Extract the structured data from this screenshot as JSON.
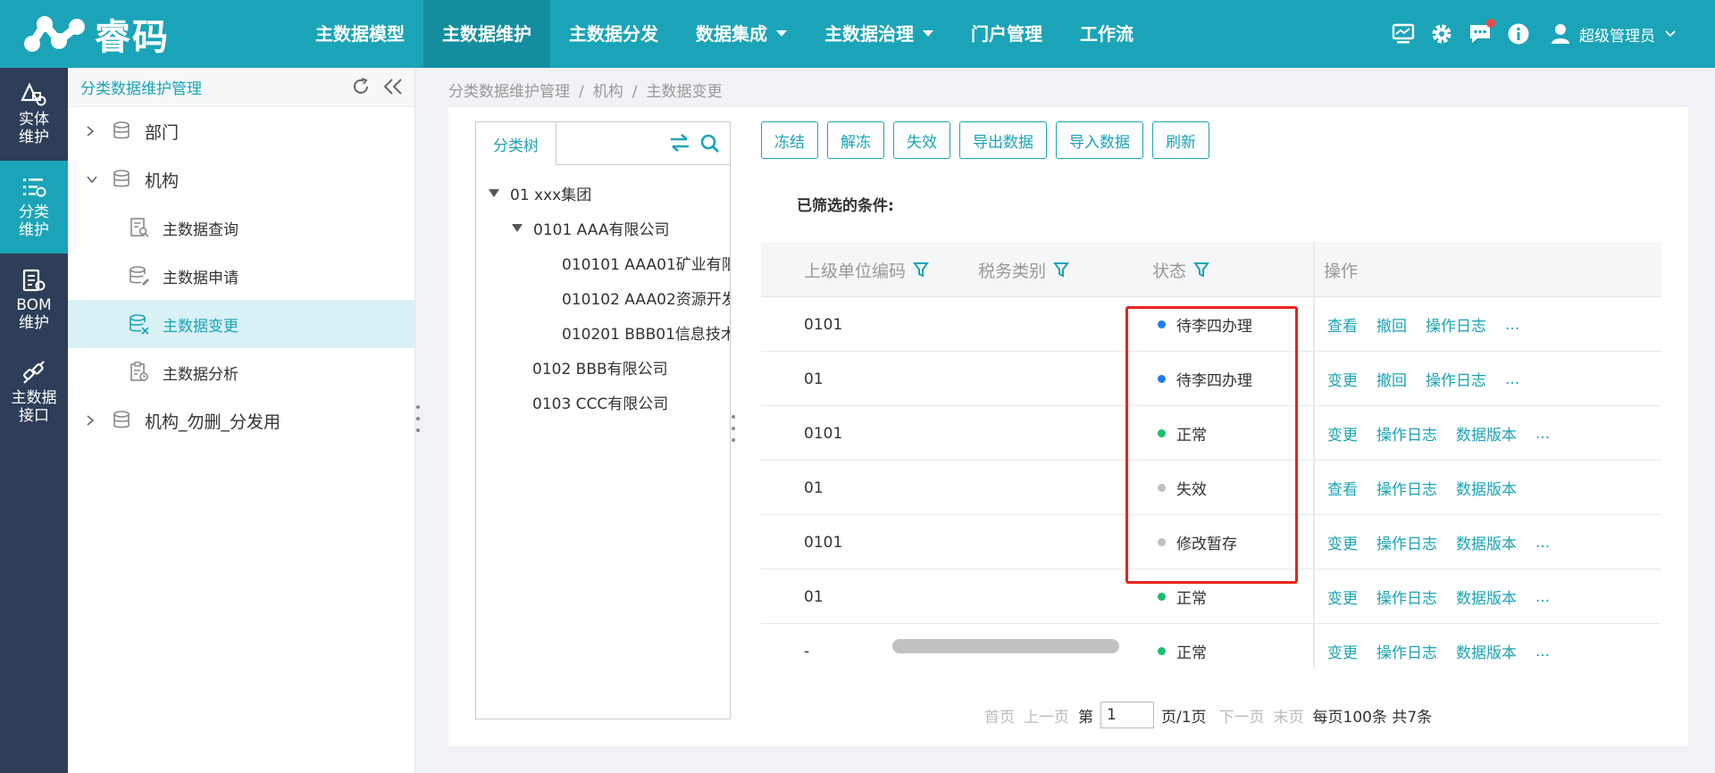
{
  "brand": {
    "name": "睿码"
  },
  "nav": {
    "items": [
      {
        "label": "主数据模型"
      },
      {
        "label": "主数据维护",
        "active": true
      },
      {
        "label": "主数据分发"
      },
      {
        "label": "数据集成",
        "dropdown": true
      },
      {
        "label": "主数据治理",
        "dropdown": true
      },
      {
        "label": "门户管理"
      },
      {
        "label": "工作流"
      }
    ]
  },
  "topbar": {
    "icons": [
      "monitor-icon",
      "gear-icon",
      "message-icon",
      "info-icon"
    ],
    "user": {
      "name": "超级管理员"
    }
  },
  "left_nav": {
    "items": [
      {
        "label": "实体\n维护",
        "icon": "entity-icon"
      },
      {
        "label": "分类\n维护",
        "icon": "classify-icon",
        "active": true
      },
      {
        "label": "BOM\n维护",
        "icon": "bom-icon"
      },
      {
        "label": "主数据\n接口",
        "icon": "interface-icon"
      }
    ]
  },
  "sidebar": {
    "title": "分类数据维护管理",
    "tree": [
      {
        "label": "部门",
        "level": 1,
        "expanded": false
      },
      {
        "label": "机构",
        "level": 1,
        "expanded": true
      },
      {
        "label": "主数据查询",
        "level": 2
      },
      {
        "label": "主数据申请",
        "level": 2
      },
      {
        "label": "主数据变更",
        "level": 2,
        "selected": true
      },
      {
        "label": "主数据分析",
        "level": 2
      },
      {
        "label": "机构_勿删_分发用",
        "level": 1,
        "expanded": false
      }
    ]
  },
  "breadcrumb": {
    "items": [
      "分类数据维护管理",
      "机构",
      "主数据变更"
    ],
    "separator": "/"
  },
  "class_tree": {
    "tab": "分类树",
    "nodes": [
      {
        "label": "01 xxx集团",
        "level": 0,
        "expanded": true
      },
      {
        "label": "0101 AAA有限公司",
        "level": 1,
        "expanded": true
      },
      {
        "label": "010101 AAA01矿业有限",
        "level": 2
      },
      {
        "label": "010102 AAA02资源开发",
        "level": 2
      },
      {
        "label": "010201 BBB01信息技术",
        "level": 2
      },
      {
        "label": "0102 BBB有限公司",
        "level": 1
      },
      {
        "label": "0103 CCC有限公司",
        "level": 1
      }
    ]
  },
  "toolbar": {
    "buttons": [
      "冻结",
      "解冻",
      "失效",
      "导出数据",
      "导入数据",
      "刷新"
    ]
  },
  "filter": {
    "label": "已筛选的条件:"
  },
  "table": {
    "columns": [
      "上级单位编码",
      "税务类别",
      "状态",
      "操作"
    ],
    "rows": [
      {
        "parent_code": "0101",
        "tax_type": "",
        "status": "待李四办理",
        "status_color": "#1f7ef0",
        "actions": [
          "查看",
          "撤回",
          "操作日志",
          "..."
        ]
      },
      {
        "parent_code": "01",
        "tax_type": "",
        "status": "待李四办理",
        "status_color": "#1f7ef0",
        "actions": [
          "变更",
          "撤回",
          "操作日志",
          "..."
        ]
      },
      {
        "parent_code": "0101",
        "tax_type": "",
        "status": "正常",
        "status_color": "#19be6b",
        "actions": [
          "变更",
          "操作日志",
          "数据版本",
          "..."
        ]
      },
      {
        "parent_code": "01",
        "tax_type": "",
        "status": "失效",
        "status_color": "#c0c0c0",
        "actions": [
          "查看",
          "操作日志",
          "数据版本"
        ]
      },
      {
        "parent_code": "0101",
        "tax_type": "",
        "status": "修改暂存",
        "status_color": "#c0c0c0",
        "actions": [
          "变更",
          "操作日志",
          "数据版本",
          "..."
        ]
      },
      {
        "parent_code": "01",
        "tax_type": "",
        "status": "正常",
        "status_color": "#19be6b",
        "actions": [
          "变更",
          "操作日志",
          "数据版本",
          "..."
        ]
      },
      {
        "parent_code": "-",
        "tax_type": "",
        "status": "正常",
        "status_color": "#19be6b",
        "actions": [
          "变更",
          "操作日志",
          "数据版本",
          "..."
        ]
      }
    ]
  },
  "pagination": {
    "first": "首页",
    "prev": "上一页",
    "page_prefix": "第",
    "current_page": "1",
    "page_suffix": "页/1页",
    "next": "下一页",
    "last": "末页",
    "summary": "每页100条 共7条"
  },
  "colors": {
    "accent": "#1ba4b8",
    "highlight": "#e8251c"
  }
}
